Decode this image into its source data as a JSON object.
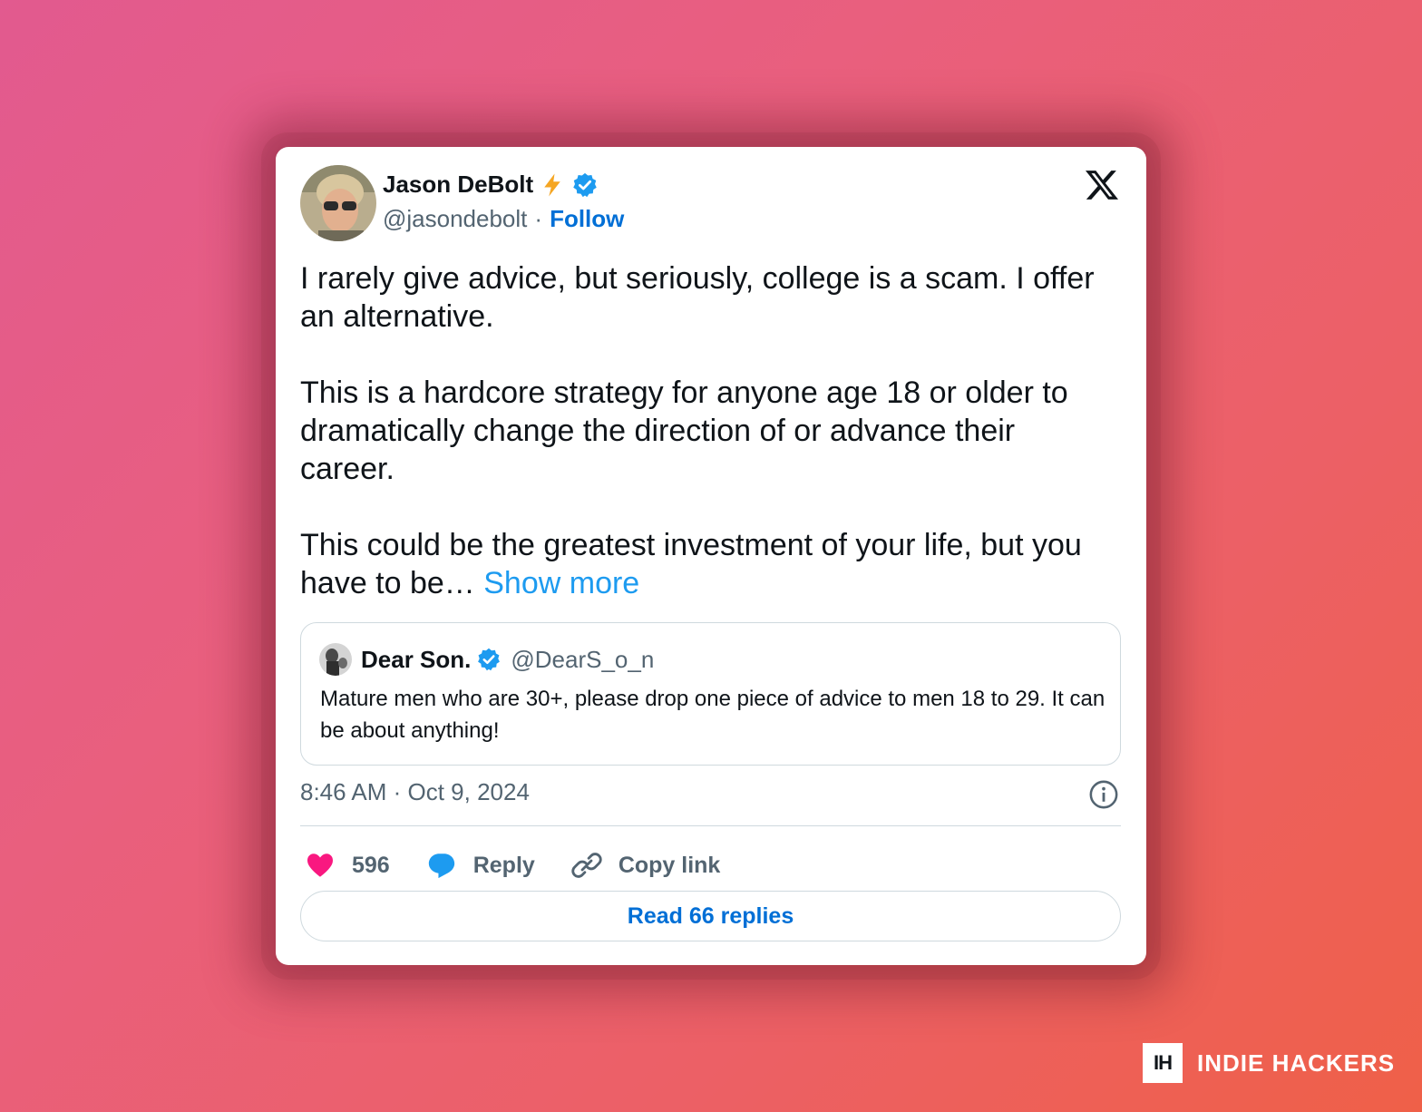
{
  "tweet": {
    "author_name": "Jason DeBolt",
    "author_handle": "@jasondebolt",
    "separator": "·",
    "follow_label": "Follow",
    "paragraphs": [
      "I rarely give advice, but seriously, college is a scam. I offer an alternative.",
      "This is a hardcore strategy for anyone age 18 or older to dramatically change the direction of or advance their career.",
      "This could be the greatest investment of your life, but you have to be… "
    ],
    "show_more_label": "Show more",
    "timestamp": "8:46 AM · Oct 9, 2024"
  },
  "quote": {
    "name": "Dear Son.",
    "handle": "@DearS_o_n",
    "text": "Mature men who are 30+, please drop one piece of advice to men 18 to 29. It can be about anything!"
  },
  "actions": {
    "likes": "596",
    "reply_label": "Reply",
    "copy_link_label": "Copy link"
  },
  "read_replies_label": "Read 66 replies",
  "brand": {
    "logo_text": "IH",
    "name": "INDIE HACKERS"
  },
  "colors": {
    "link_blue": "#006fd6",
    "show_more_blue": "#1d9bf0",
    "like_pink": "#f91880",
    "verified_blue": "#1d9bf0",
    "bolt_yellow": "#f5a623"
  },
  "icons": [
    "bolt-icon",
    "verified-badge-icon",
    "x-logo-icon",
    "info-icon",
    "heart-icon",
    "reply-bubble-icon",
    "link-icon"
  ]
}
